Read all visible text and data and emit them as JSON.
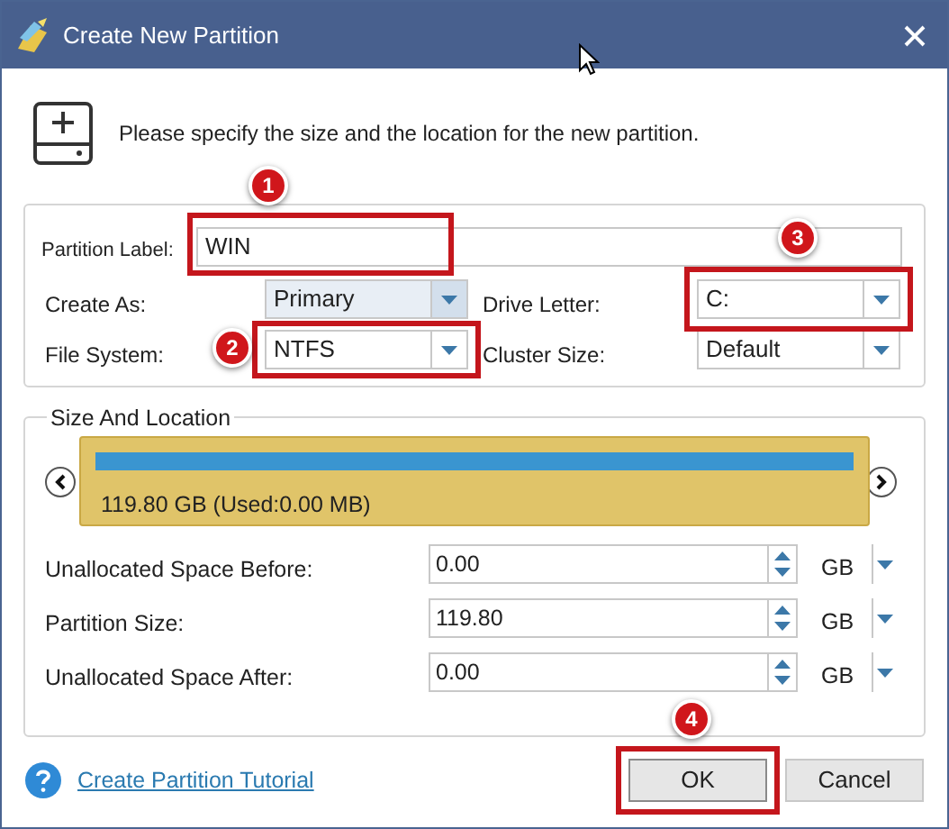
{
  "window": {
    "title": "Create New Partition"
  },
  "instruction": "Please specify the size and the location for the new partition.",
  "partition_label": {
    "label": "Partition Label:",
    "value": "WIN",
    "step": "1"
  },
  "create_as": {
    "label": "Create As:",
    "value": "Primary"
  },
  "drive_letter": {
    "label": "Drive Letter:",
    "value": "C:",
    "step": "3"
  },
  "file_system": {
    "label": "File System:",
    "value": "NTFS",
    "step": "2"
  },
  "cluster_size": {
    "label": "Cluster Size:",
    "value": "Default"
  },
  "size_and_location": {
    "title": "Size And Location",
    "disk_text": "119.80 GB (Used:0.00 MB)",
    "level": 1,
    "rows": [
      {
        "label": "Unallocated Space Before:",
        "value": "0.00",
        "unit": "GB"
      },
      {
        "label": "Partition Size:",
        "value": "119.80",
        "unit": "GB"
      },
      {
        "label": "Unallocated Space After:",
        "value": "0.00",
        "unit": "GB"
      }
    ]
  },
  "tutorial_link": "Create Partition Tutorial",
  "buttons": [
    {
      "label": "OK",
      "step": "4"
    },
    {
      "label": "Cancel"
    }
  ]
}
